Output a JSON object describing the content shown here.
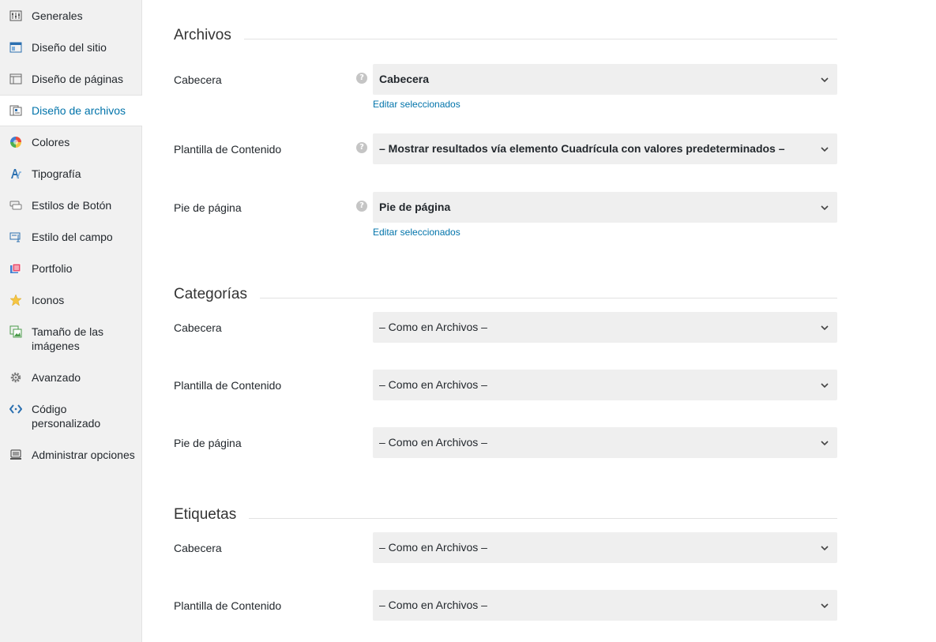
{
  "sidebar": {
    "items": [
      {
        "label": "Generales",
        "icon": "sliders-icon"
      },
      {
        "label": "Diseño del sitio",
        "icon": "site-layout-icon"
      },
      {
        "label": "Diseño de páginas",
        "icon": "page-layout-icon"
      },
      {
        "label": "Diseño de archivos",
        "icon": "archive-layout-icon",
        "active": true
      },
      {
        "label": "Colores",
        "icon": "color-wheel-icon"
      },
      {
        "label": "Tipografía",
        "icon": "typography-icon"
      },
      {
        "label": "Estilos de Botón",
        "icon": "button-style-icon"
      },
      {
        "label": "Estilo del campo",
        "icon": "field-style-icon"
      },
      {
        "label": "Portfolio",
        "icon": "portfolio-icon"
      },
      {
        "label": "Iconos",
        "icon": "star-icon"
      },
      {
        "label": "Tamaño de las imágenes",
        "icon": "image-size-icon"
      },
      {
        "label": "Avanzado",
        "icon": "gear-icon"
      },
      {
        "label": "Código personalizado",
        "icon": "code-icon"
      },
      {
        "label": "Administrar opciones",
        "icon": "manage-options-icon"
      }
    ]
  },
  "colors": {
    "accent": "#0073aa",
    "sidebar_bg": "#f1f1f1",
    "select_bg": "#efefef"
  },
  "sections": {
    "archivos": {
      "title": "Archivos",
      "header_label": "Cabecera",
      "header_value": "Cabecera",
      "content_label": "Plantilla de Contenido",
      "content_value": "– Mostrar resultados vía elemento Cuadrícula con valores predeterminados –",
      "footer_label": "Pie de página",
      "footer_value": "Pie de página",
      "edit_link": "Editar seleccionados"
    },
    "categorias": {
      "title": "Categorías",
      "header_label": "Cabecera",
      "header_value": "– Como en Archivos –",
      "content_label": "Plantilla de Contenido",
      "content_value": "– Como en Archivos –",
      "footer_label": "Pie de página",
      "footer_value": "– Como en Archivos –"
    },
    "etiquetas": {
      "title": "Etiquetas",
      "header_label": "Cabecera",
      "header_value": "– Como en Archivos –",
      "content_label": "Plantilla de Contenido",
      "content_value": "– Como en Archivos –"
    }
  },
  "help_glyph": "?"
}
